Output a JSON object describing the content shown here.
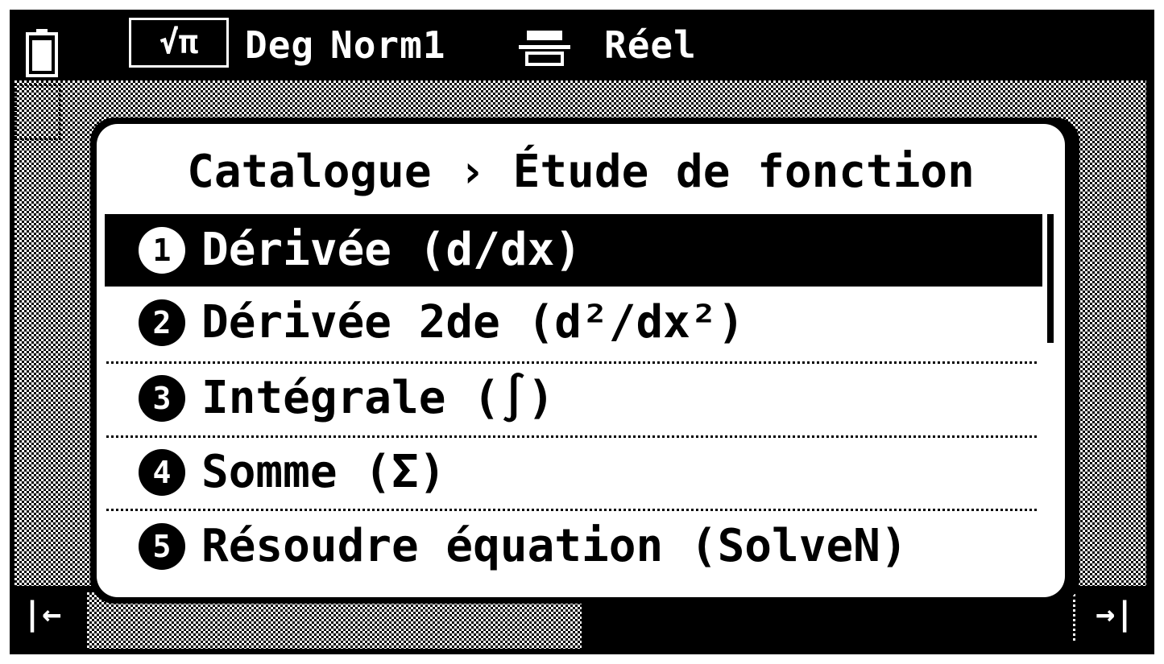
{
  "status_bar": {
    "mode_label": "√π",
    "angle": "Deg",
    "notation": "Norm1",
    "number_type": "Réel"
  },
  "dialog": {
    "title": "Catalogue › Étude de fonction",
    "items": [
      {
        "number": "1",
        "label": "Dérivée (d/dx)",
        "selected": true
      },
      {
        "number": "2",
        "label": "Dérivée 2de (d²/dx²)",
        "selected": false
      },
      {
        "number": "3",
        "label": "Intégrale (∫)",
        "selected": false
      },
      {
        "number": "4",
        "label": "Somme (Σ)",
        "selected": false
      },
      {
        "number": "5",
        "label": "Résoudre équation (SolveN)",
        "selected": false
      }
    ]
  },
  "bottom_bar": {
    "left_arrow": "|←",
    "right_arrow": "→|"
  },
  "colors": {
    "foreground": "#000000",
    "background": "#ffffff"
  }
}
